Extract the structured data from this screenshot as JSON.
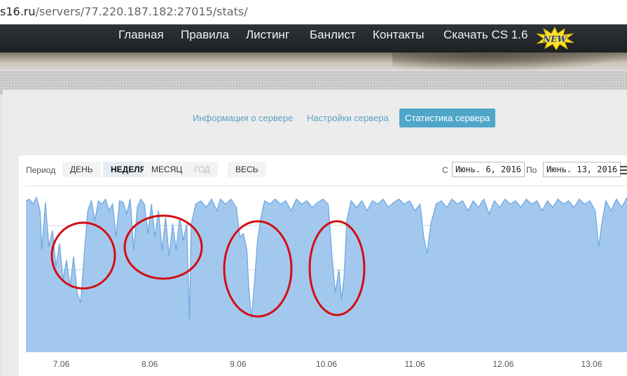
{
  "browser": {
    "url_host": "s16.ru",
    "url_path": "/servers/77.220.187.182:27015/stats/"
  },
  "nav": {
    "items": [
      "Главная",
      "Правила",
      "Листинг",
      "Банлист",
      "Контакты",
      "Скачать CS 1.6"
    ],
    "badge": "NEW"
  },
  "tabs": {
    "items": [
      "Информация о сервере",
      "Настройки сервера",
      "Статистика сервера"
    ],
    "active": "Статистика сервера"
  },
  "toolbar": {
    "period_label": "Период",
    "ranges": [
      "ДЕНЬ",
      "НЕДЕЛЯ",
      "МЕСЯЦ",
      "ГОД",
      "ВЕСЬ"
    ],
    "active_range": "НЕДЕЛЯ",
    "disabled_range": "ГОД",
    "from_label": "С",
    "from_value": "Июнь. 6, 2016",
    "to_label": "По",
    "to_value": "Июнь. 13, 2016"
  },
  "chart_data": {
    "type": "area",
    "x_ticks": [
      "7.06",
      "8.06",
      "9.06",
      "10.06",
      "11.06",
      "12.06",
      "13.06"
    ],
    "x_range_days": [
      6.6,
      13.4
    ],
    "y_range": [
      0,
      1
    ],
    "series": [
      {
        "color": "#6fa8e0",
        "fill": "#a3c8ee",
        "points": [
          [
            6.6,
            0.92
          ],
          [
            6.64,
            0.93
          ],
          [
            6.68,
            0.9
          ],
          [
            6.72,
            0.94
          ],
          [
            6.76,
            0.86
          ],
          [
            6.78,
            0.62
          ],
          [
            6.82,
            0.91
          ],
          [
            6.86,
            0.64
          ],
          [
            6.9,
            0.74
          ],
          [
            6.94,
            0.52
          ],
          [
            6.98,
            0.66
          ],
          [
            7.02,
            0.44
          ],
          [
            7.06,
            0.56
          ],
          [
            7.1,
            0.4
          ],
          [
            7.14,
            0.58
          ],
          [
            7.18,
            0.36
          ],
          [
            7.22,
            0.3
          ],
          [
            7.26,
            0.6
          ],
          [
            7.3,
            0.86
          ],
          [
            7.34,
            0.92
          ],
          [
            7.38,
            0.8
          ],
          [
            7.42,
            0.92
          ],
          [
            7.46,
            0.9
          ],
          [
            7.5,
            0.93
          ],
          [
            7.54,
            0.86
          ],
          [
            7.58,
            0.9
          ],
          [
            7.62,
            0.7
          ],
          [
            7.66,
            0.92
          ],
          [
            7.7,
            0.91
          ],
          [
            7.74,
            0.84
          ],
          [
            7.78,
            0.93
          ],
          [
            7.82,
            0.62
          ],
          [
            7.86,
            0.88
          ],
          [
            7.9,
            0.93
          ],
          [
            7.94,
            0.9
          ],
          [
            7.98,
            0.72
          ],
          [
            8.02,
            0.9
          ],
          [
            8.06,
            0.7
          ],
          [
            8.1,
            0.86
          ],
          [
            8.14,
            0.62
          ],
          [
            8.18,
            0.82
          ],
          [
            8.22,
            0.58
          ],
          [
            8.26,
            0.78
          ],
          [
            8.3,
            0.62
          ],
          [
            8.34,
            0.82
          ],
          [
            8.38,
            0.68
          ],
          [
            8.42,
            0.78
          ],
          [
            8.45,
            0.2
          ],
          [
            8.47,
            0.78
          ],
          [
            8.52,
            0.9
          ],
          [
            8.58,
            0.92
          ],
          [
            8.64,
            0.88
          ],
          [
            8.7,
            0.93
          ],
          [
            8.76,
            0.86
          ],
          [
            8.8,
            0.93
          ],
          [
            8.86,
            0.9
          ],
          [
            8.92,
            0.93
          ],
          [
            8.98,
            0.88
          ],
          [
            9.02,
            0.7
          ],
          [
            9.06,
            0.72
          ],
          [
            9.1,
            0.62
          ],
          [
            9.12,
            0.4
          ],
          [
            9.15,
            0.2
          ],
          [
            9.18,
            0.38
          ],
          [
            9.22,
            0.68
          ],
          [
            9.26,
            0.82
          ],
          [
            9.3,
            0.92
          ],
          [
            9.36,
            0.9
          ],
          [
            9.42,
            0.93
          ],
          [
            9.48,
            0.9
          ],
          [
            9.54,
            0.92
          ],
          [
            9.6,
            0.86
          ],
          [
            9.66,
            0.93
          ],
          [
            9.72,
            0.9
          ],
          [
            9.78,
            0.92
          ],
          [
            9.84,
            0.88
          ],
          [
            9.9,
            0.91
          ],
          [
            9.96,
            0.93
          ],
          [
            10.02,
            0.9
          ],
          [
            10.06,
            0.6
          ],
          [
            10.1,
            0.36
          ],
          [
            10.14,
            0.5
          ],
          [
            10.17,
            0.32
          ],
          [
            10.2,
            0.46
          ],
          [
            10.23,
            0.8
          ],
          [
            10.28,
            0.92
          ],
          [
            10.34,
            0.88
          ],
          [
            10.4,
            0.92
          ],
          [
            10.46,
            0.86
          ],
          [
            10.52,
            0.92
          ],
          [
            10.58,
            0.9
          ],
          [
            10.64,
            0.93
          ],
          [
            10.7,
            0.88
          ],
          [
            10.76,
            0.91
          ],
          [
            10.82,
            0.93
          ],
          [
            10.88,
            0.9
          ],
          [
            10.94,
            0.92
          ],
          [
            11.0,
            0.86
          ],
          [
            11.06,
            0.9
          ],
          [
            11.1,
            0.7
          ],
          [
            11.14,
            0.6
          ],
          [
            11.18,
            0.78
          ],
          [
            11.24,
            0.9
          ],
          [
            11.3,
            0.92
          ],
          [
            11.36,
            0.88
          ],
          [
            11.42,
            0.93
          ],
          [
            11.48,
            0.9
          ],
          [
            11.54,
            0.92
          ],
          [
            11.6,
            0.86
          ],
          [
            11.66,
            0.92
          ],
          [
            11.72,
            0.88
          ],
          [
            11.78,
            0.93
          ],
          [
            11.84,
            0.84
          ],
          [
            11.9,
            0.92
          ],
          [
            11.96,
            0.88
          ],
          [
            12.02,
            0.93
          ],
          [
            12.08,
            0.9
          ],
          [
            12.14,
            0.92
          ],
          [
            12.2,
            0.88
          ],
          [
            12.26,
            0.93
          ],
          [
            12.32,
            0.9
          ],
          [
            12.38,
            0.92
          ],
          [
            12.44,
            0.86
          ],
          [
            12.5,
            0.92
          ],
          [
            12.56,
            0.88
          ],
          [
            12.62,
            0.93
          ],
          [
            12.68,
            0.9
          ],
          [
            12.74,
            0.92
          ],
          [
            12.8,
            0.88
          ],
          [
            12.86,
            0.93
          ],
          [
            12.92,
            0.9
          ],
          [
            12.98,
            0.92
          ],
          [
            13.04,
            0.86
          ],
          [
            13.08,
            0.64
          ],
          [
            13.12,
            0.8
          ],
          [
            13.16,
            0.92
          ],
          [
            13.22,
            0.86
          ],
          [
            13.28,
            0.93
          ],
          [
            13.34,
            0.88
          ],
          [
            13.4,
            0.94
          ]
        ]
      }
    ]
  },
  "annotations": {
    "circle_color": "#d40d12"
  }
}
